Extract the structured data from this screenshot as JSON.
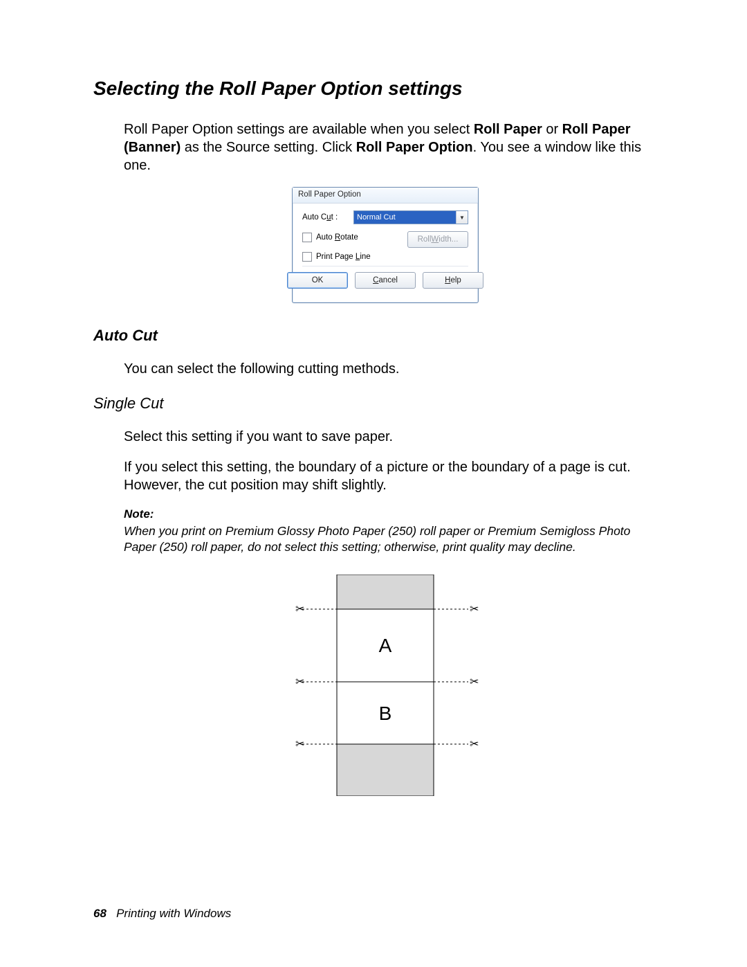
{
  "heading_main": "Selecting the Roll Paper Option settings",
  "intro": {
    "pre": "Roll Paper Option settings are available when you select ",
    "b1": "Roll Paper",
    "mid1": " or ",
    "b2": "Roll Paper (Banner)",
    "mid2": " as the Source setting. Click ",
    "b3": "Roll Paper Option",
    "post": ". You see a window like this one."
  },
  "dialog": {
    "title": "Roll Paper Option",
    "autocut_label": "Auto Cut :",
    "autocut_value": "Normal Cut",
    "autorotate": "Auto Rotate",
    "rollwidth": "Roll Width...",
    "printpageline": "Print Page Line",
    "ok": "OK",
    "cancel": "Cancel",
    "help": "Help"
  },
  "h_autocut": "Auto Cut",
  "p_autocut": "You can select the following cutting methods.",
  "h_singlecut": "Single Cut",
  "p_single1": "Select this setting if you want to save paper.",
  "p_single2": "If you select this setting, the boundary of a picture or the boundary of a page is cut. However, the cut position may shift slightly.",
  "note_label": "Note:",
  "note_body": "When you print on Premium Glossy Photo Paper (250) roll paper or Premium Semigloss Photo Paper (250) roll paper, do not select this setting; otherwise, print quality may decline.",
  "diagram": {
    "a": "A",
    "b": "B"
  },
  "footer": {
    "page": "68",
    "title": "Printing with Windows"
  }
}
